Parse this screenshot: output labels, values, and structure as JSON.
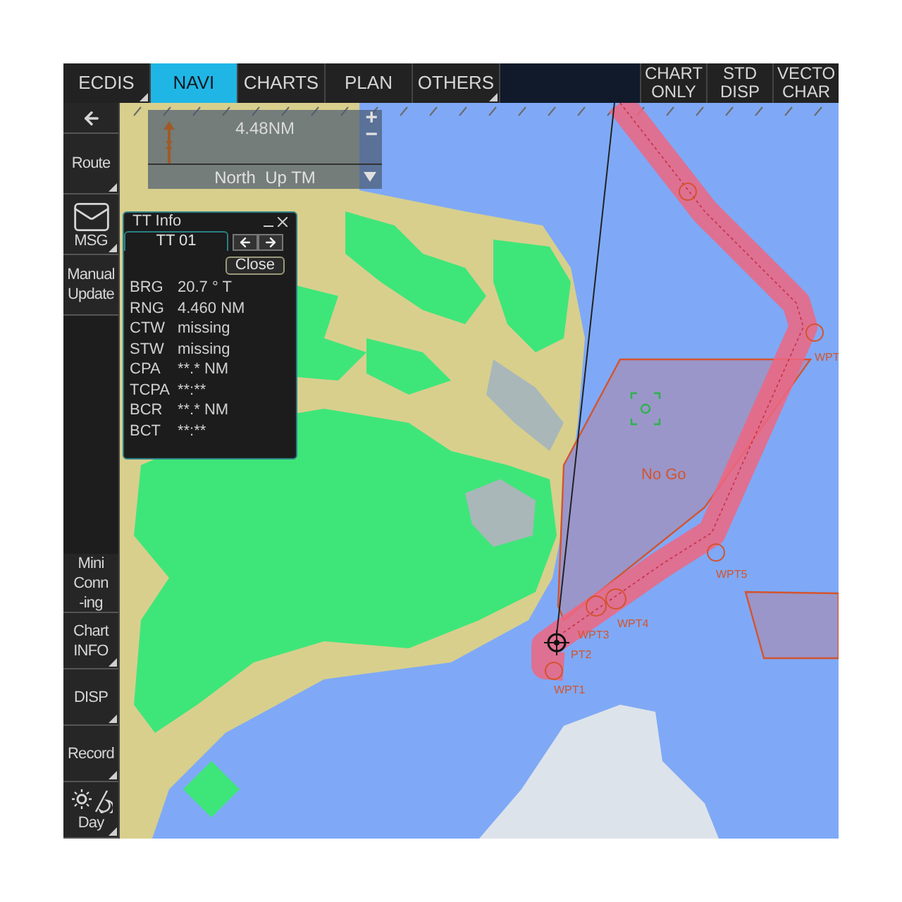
{
  "top_tabs": [
    {
      "label": "ECDIS",
      "selected": false,
      "menu": true
    },
    {
      "label": "NAVI",
      "selected": true,
      "menu": false
    },
    {
      "label": "CHARTS",
      "selected": false,
      "menu": false
    },
    {
      "label": "PLAN",
      "selected": false,
      "menu": false
    },
    {
      "label": "OTHERS",
      "selected": false,
      "menu": true
    }
  ],
  "right_buttons": [
    {
      "label": "CHART\nONLY"
    },
    {
      "label": "STD\nDISP"
    },
    {
      "label": "VECTO\nCHAR"
    }
  ],
  "sidebar_top": [
    {
      "kind": "arrow",
      "menu": false
    },
    {
      "kind": "text",
      "label": "Route",
      "menu": true
    },
    {
      "kind": "mail",
      "label": "MSG",
      "menu": true
    },
    {
      "kind": "text",
      "label": "Manual\nUpdate",
      "menu": false
    }
  ],
  "sidebar_bottom": [
    {
      "kind": "text",
      "label": "Mini\nConn\n-ing",
      "menu": false
    },
    {
      "kind": "text",
      "label": "Chart\nINFO",
      "menu": true
    },
    {
      "kind": "text",
      "label": "DISP",
      "menu": true
    },
    {
      "kind": "text",
      "label": "Record",
      "menu": true
    },
    {
      "kind": "day",
      "label": "Day",
      "menu": true
    }
  ],
  "scale_widget": {
    "range": "4.48NM",
    "zoom_in": "+",
    "zoom_out": "−",
    "mode": "North  Up TM"
  },
  "tt_info": {
    "title": "TT Info",
    "tab": "TT 01",
    "close": "Close",
    "rows": [
      {
        "label": "BRG",
        "value": "20.7 ° T"
      },
      {
        "label": "RNG",
        "value": "4.460 NM"
      },
      {
        "label": "CTW",
        "value": "missing"
      },
      {
        "label": "STW",
        "value": "missing"
      },
      {
        "label": "CPA",
        "value": "**.* NM"
      },
      {
        "label": "TCPA",
        "value": "**:**"
      },
      {
        "label": "BCR",
        "value": "**.* NM"
      },
      {
        "label": "BCT",
        "value": "**:**"
      }
    ]
  },
  "chart": {
    "area_label": "No Go",
    "waypoints": [
      {
        "label": "WPT1"
      },
      {
        "label": "PT2"
      },
      {
        "label": "WPT3"
      },
      {
        "label": "WPT4"
      },
      {
        "label": "WPT5"
      },
      {
        "label": "WPT"
      }
    ]
  }
}
